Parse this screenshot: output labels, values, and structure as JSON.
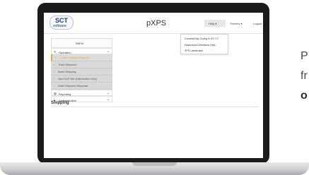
{
  "promo": {
    "line1": "P",
    "line2": "fr",
    "line3": "o"
  },
  "app": {
    "logo_main": "SCT",
    "logo_sub": "software",
    "title": "pXPS"
  },
  "nav": {
    "help": "Help ▾",
    "themes": "Themes ▾",
    "logout": "Logout"
  },
  "help_menu": {
    "items": [
      "ConnectShip Config in XS 7.0",
      "Hazardous Definitions Help",
      "XPS Landscape"
    ]
  },
  "sidebar": {
    "menu_title": "Menu",
    "operation": {
      "label": "Operation",
      "icon": "pencil-icon"
    },
    "operation_items": [
      "Create Shipping Request",
      "Track Shipment",
      "Batch Shipping",
      "New KAF Site (Distribution Only)",
      "Draft Shipment Requests"
    ],
    "reporting": {
      "label": "Reporting",
      "icon": "bar-chart-icon"
    },
    "administration": {
      "label": "Administration",
      "icon": "lock-icon"
    }
  },
  "main": {
    "heading": "Shipping"
  },
  "colors": {
    "active_item": "#e8a54a",
    "brand": "#1d3d6b",
    "laptop_bezel": "#1b1b1d"
  }
}
